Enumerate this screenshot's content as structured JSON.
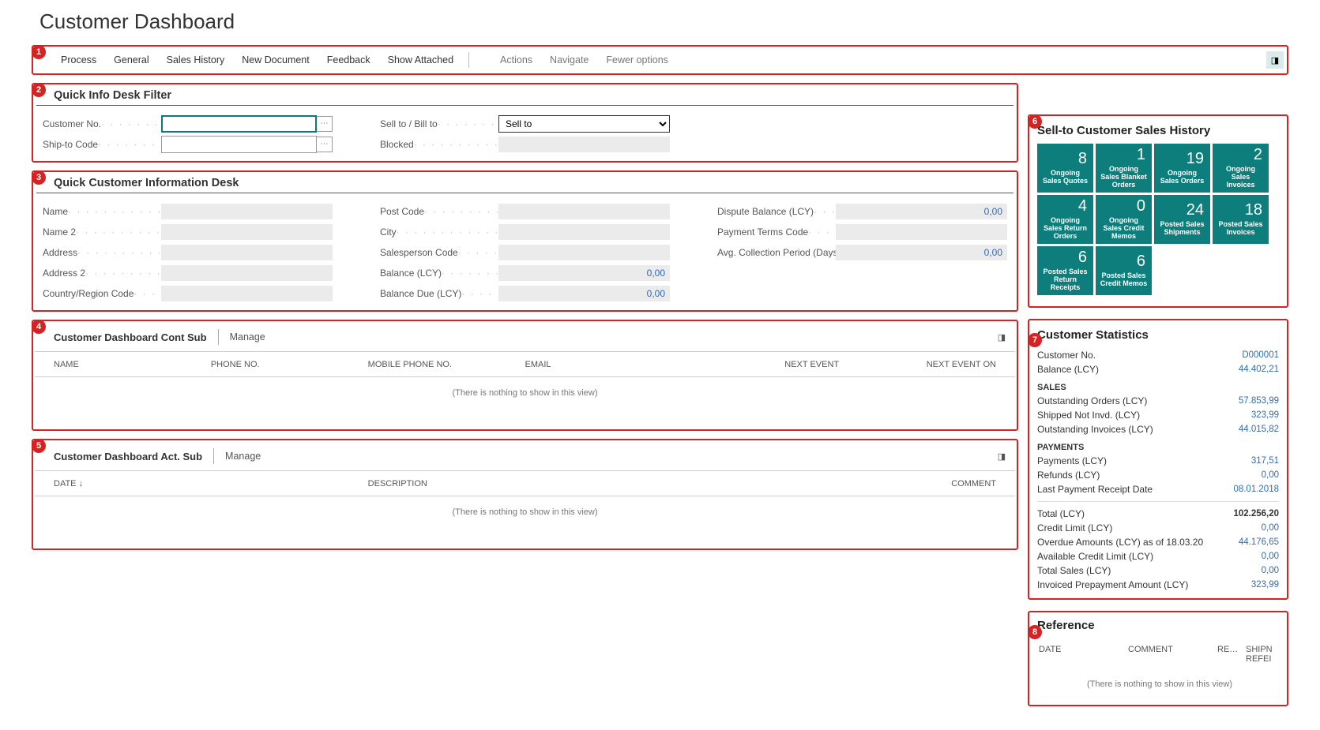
{
  "pageTitle": "Customer Dashboard",
  "annotations": [
    "1",
    "2",
    "3",
    "4",
    "5",
    "6",
    "7",
    "8"
  ],
  "actionBar": {
    "primary": [
      "Process",
      "General",
      "Sales History",
      "New Document",
      "Feedback",
      "Show Attached"
    ],
    "secondary": [
      "Actions",
      "Navigate",
      "Fewer options"
    ]
  },
  "filter": {
    "title": "Quick Info Desk Filter",
    "customerNoLabel": "Customer No.",
    "customerNoValue": "",
    "shipToLabel": "Ship-to Code",
    "shipToValue": "",
    "sellToBillLabel": "Sell to / Bill to",
    "sellToBillValue": "Sell to",
    "blockedLabel": "Blocked",
    "blockedValue": ""
  },
  "info": {
    "title": "Quick Customer Information Desk",
    "col1": [
      {
        "label": "Name",
        "value": ""
      },
      {
        "label": "Name 2",
        "value": ""
      },
      {
        "label": "Address",
        "value": ""
      },
      {
        "label": "Address 2",
        "value": ""
      },
      {
        "label": "Country/Region Code",
        "value": ""
      }
    ],
    "col2": [
      {
        "label": "Post Code",
        "value": "",
        "type": "text"
      },
      {
        "label": "City",
        "value": "",
        "type": "text"
      },
      {
        "label": "Salesperson Code",
        "value": "",
        "type": "text"
      },
      {
        "label": "Balance (LCY)",
        "value": "0,00",
        "type": "num"
      },
      {
        "label": "Balance Due (LCY)",
        "value": "0,00",
        "type": "num"
      }
    ],
    "col3": [
      {
        "label": "Dispute Balance (LCY)",
        "value": "0,00",
        "type": "num"
      },
      {
        "label": "Payment Terms Code",
        "value": "",
        "type": "text"
      },
      {
        "label": "Avg. Collection Period (Days)",
        "value": "0,00",
        "type": "num"
      }
    ]
  },
  "sub1": {
    "title": "Customer Dashboard Cont Sub",
    "action": "Manage",
    "cols": [
      "NAME",
      "PHONE NO.",
      "MOBILE PHONE NO.",
      "EMAIL",
      "NEXT EVENT",
      "NEXT EVENT ON"
    ],
    "empty": "(There is nothing to show in this view)"
  },
  "sub2": {
    "title": "Customer Dashboard Act. Sub",
    "action": "Manage",
    "cols": [
      "DATE ↓",
      "DESCRIPTION",
      "COMMENT"
    ],
    "empty": "(There is nothing to show in this view)"
  },
  "salesHistory": {
    "title": "Sell-to Customer Sales History",
    "tiles": [
      {
        "n": "8",
        "c": "Ongoing Sales Quotes"
      },
      {
        "n": "1",
        "c": "Ongoing Sales Blanket Orders"
      },
      {
        "n": "19",
        "c": "Ongoing Sales Orders"
      },
      {
        "n": "2",
        "c": "Ongoing Sales Invoices"
      },
      {
        "n": "4",
        "c": "Ongoing Sales Return Orders"
      },
      {
        "n": "0",
        "c": "Ongoing Sales Credit Memos"
      },
      {
        "n": "24",
        "c": "Posted Sales Shipments"
      },
      {
        "n": "18",
        "c": "Posted Sales Invoices"
      },
      {
        "n": "6",
        "c": "Posted Sales Return Receipts"
      },
      {
        "n": "6",
        "c": "Posted Sales Credit Memos"
      }
    ]
  },
  "stats": {
    "title": "Customer Statistics",
    "rows1": [
      {
        "l": "Customer No.",
        "v": "D000001"
      },
      {
        "l": "Balance (LCY)",
        "v": "44.402,21"
      }
    ],
    "salesHead": "SALES",
    "rows2": [
      {
        "l": "Outstanding Orders (LCY)",
        "v": "57.853,99"
      },
      {
        "l": "Shipped Not Invd. (LCY)",
        "v": "323,99"
      },
      {
        "l": "Outstanding Invoices (LCY)",
        "v": "44.015,82"
      }
    ],
    "payHead": "PAYMENTS",
    "rows3": [
      {
        "l": "Payments (LCY)",
        "v": "317,51"
      },
      {
        "l": "Refunds (LCY)",
        "v": "0,00"
      },
      {
        "l": "Last Payment Receipt Date",
        "v": "08.01.2018"
      }
    ],
    "totalLabel": "Total (LCY)",
    "totalValue": "102.256,20",
    "rows4": [
      {
        "l": "Credit Limit (LCY)",
        "v": "0,00"
      },
      {
        "l": "Overdue Amounts (LCY) as of 18.03.20",
        "v": "44.176,65"
      },
      {
        "l": "Available Credit Limit (LCY)",
        "v": "0,00"
      },
      {
        "l": "Total Sales (LCY)",
        "v": "0,00"
      },
      {
        "l": "Invoiced Prepayment Amount (LCY)",
        "v": "323,99"
      }
    ]
  },
  "ref": {
    "title": "Reference",
    "cols": [
      "DATE",
      "COMMENT",
      "RE…",
      "SHIPN REFEI"
    ],
    "empty": "(There is nothing to show in this view)"
  }
}
